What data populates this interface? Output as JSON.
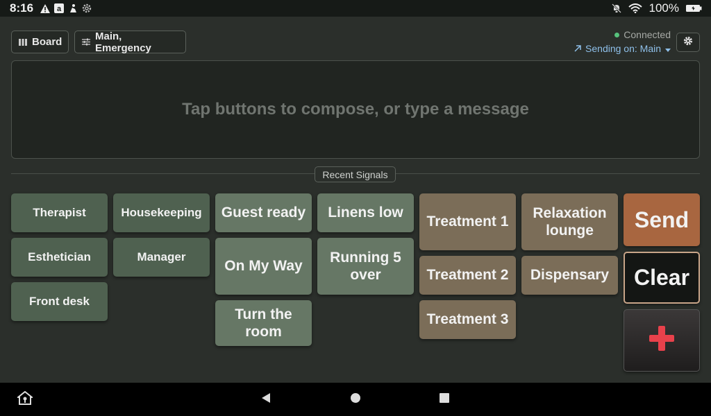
{
  "status_bar": {
    "time": "8:16",
    "battery": "100%",
    "left_icons": [
      "warning-icon",
      "amazon-icon",
      "person-icon",
      "settings-icon"
    ],
    "right_icons": [
      "bell-off-icon",
      "wifi-icon",
      "battery-icon"
    ]
  },
  "header": {
    "board_label": "Board",
    "channels_label": "Main, Emergency",
    "connection_status": "Connected",
    "sending_on": "Sending on: Main",
    "connected_color": "#57c27c"
  },
  "compose": {
    "placeholder": "Tap buttons to compose, or type a message"
  },
  "recent_signals_label": "Recent Signals",
  "roles": [
    "Therapist",
    "Housekeeping",
    "Esthetician",
    "Manager",
    "Front desk"
  ],
  "messages": [
    "Guest ready",
    "Linens low",
    "On My Way",
    "Running 5 over",
    "Turn the room"
  ],
  "rooms": [
    "Treatment 1",
    "Relaxation lounge",
    "Treatment 2",
    "Dispensary",
    "Treatment 3"
  ],
  "actions": {
    "send": "Send",
    "clear": "Clear",
    "emergency_icon": "red-cross-icon"
  },
  "colors": {
    "role_tile": "#4f6150",
    "message_tile": "#667765",
    "room_tile": "#7b6d58",
    "send": "#a86640",
    "emergency_cross": "#e8414b"
  }
}
